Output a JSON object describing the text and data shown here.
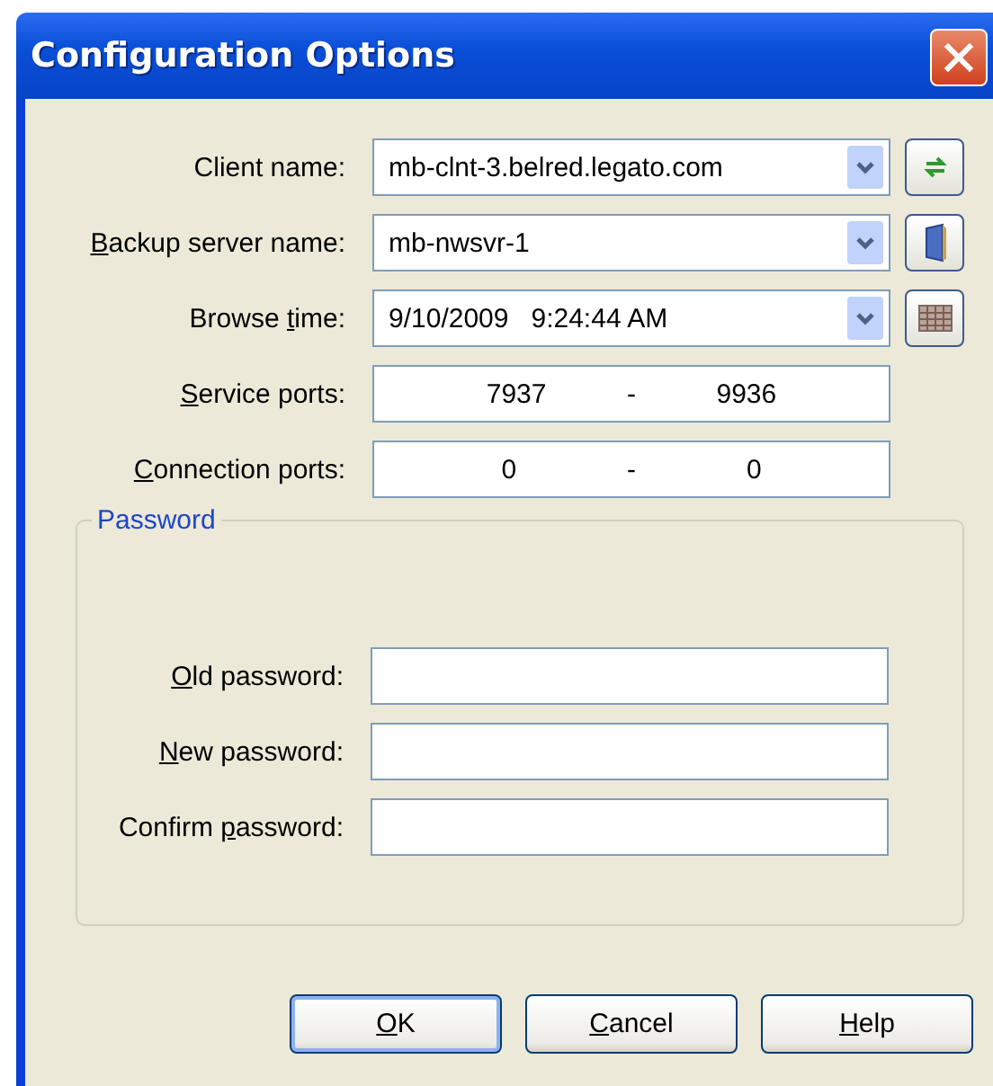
{
  "window": {
    "title": "Configuration Options"
  },
  "fields": [
    {
      "kind": "combo",
      "label": {
        "post": "Client name:"
      },
      "value": "mb-clnt-3.belred.legato.com",
      "side_button": {
        "kind": "refresh"
      }
    },
    {
      "kind": "combo",
      "label": {
        "key": "B",
        "post": "ackup server name:"
      },
      "value": "mb-nwsvr-1",
      "side_button": {
        "kind": "server"
      }
    },
    {
      "kind": "combo",
      "label": {
        "pre": "Browse ",
        "key": "t",
        "post": "ime:"
      },
      "value": "9/10/2009   9:24:44 AM",
      "side_button": {
        "kind": "calendar"
      }
    },
    {
      "kind": "range",
      "label": {
        "key": "S",
        "post": "ervice ports:"
      },
      "from": "7937",
      "separator": "-",
      "to": "9936"
    },
    {
      "kind": "range",
      "label": {
        "key": "C",
        "post": "onnection ports:"
      },
      "from": "0",
      "separator": "-",
      "to": "0"
    }
  ],
  "password_group": {
    "title": "Password",
    "fields": [
      {
        "label": {
          "key": "O",
          "post": "ld password:"
        }
      },
      {
        "label": {
          "key": "N",
          "post": "ew password:"
        }
      },
      {
        "label": {
          "pre": "Confirm ",
          "key": "p",
          "post": "assword:"
        }
      }
    ]
  },
  "buttons": [
    {
      "label": {
        "key": "O",
        "post": "K"
      },
      "default": true
    },
    {
      "label": {
        "key": "C",
        "post": "ancel"
      },
      "default": false
    },
    {
      "label": {
        "key": "H",
        "post": "elp"
      },
      "default": false
    }
  ]
}
